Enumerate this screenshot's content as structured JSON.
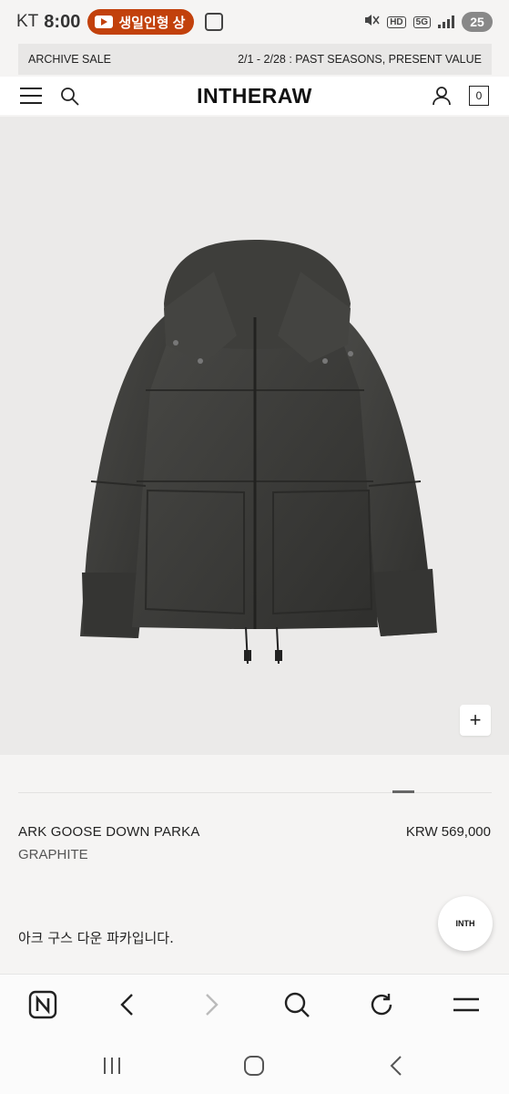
{
  "status_bar": {
    "carrier": "KT",
    "time": "8:00",
    "live_pill": "생일인형 상",
    "hd_tag": "HD",
    "network_tag": "5G",
    "battery": "25"
  },
  "announcement": {
    "left": "ARCHIVE SALE",
    "right": "2/1 - 2/28 : PAST SEASONS, PRESENT VALUE"
  },
  "header": {
    "logo": "INTHERAW",
    "cart_count": "0"
  },
  "gallery": {
    "plus_label": "+",
    "current_index": 7,
    "total": 8
  },
  "product": {
    "name": "ARK GOOSE DOWN PARKA",
    "color": "GRAPHITE",
    "price": "KRW 569,000",
    "description": "아크 구스 다운 파카입니다."
  },
  "chat": {
    "label": "INTH"
  },
  "colors": {
    "background": "#f5f4f3",
    "image_bg": "#ebeae9",
    "jacket": "#3b3b39",
    "live_pill": "#c2410c"
  }
}
